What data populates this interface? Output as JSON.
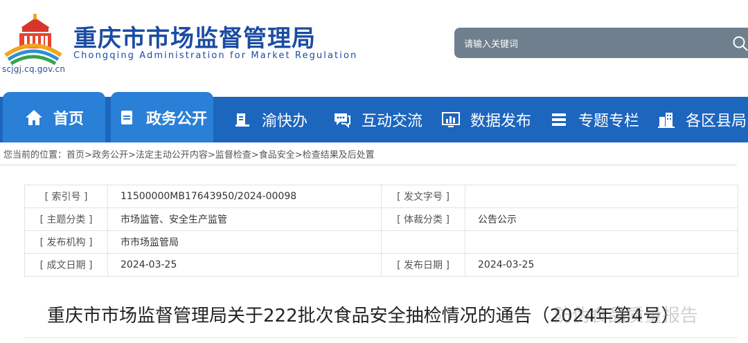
{
  "site": {
    "title": "重庆市市场监督管理局",
    "subtitle": "Chongqing  Administration for Market Regulation",
    "domain": "scjgj.cq.gov.cn",
    "logo_icon": "emblem-logo-icon"
  },
  "search": {
    "placeholder": "请输入关键词",
    "icon": "search-icon"
  },
  "nav": {
    "items": [
      {
        "label": "首页",
        "icon": "home-icon"
      },
      {
        "label": "政务公开",
        "icon": "document-icon"
      },
      {
        "label": "渝快办",
        "icon": "service-icon"
      },
      {
        "label": "互动交流",
        "icon": "chat-icon"
      },
      {
        "label": "数据发布",
        "icon": "chart-icon"
      },
      {
        "label": "专题专栏",
        "icon": "list-icon"
      },
      {
        "label": "各区县局",
        "icon": "building-icon"
      }
    ],
    "active": "政务公开"
  },
  "breadcrumb": {
    "prefix": "您当前的位置：",
    "items": [
      "首页",
      "政务公开",
      "法定主动公开内容",
      "监督检查",
      "食品安全",
      "检查结果及后处置"
    ],
    "separator": ">"
  },
  "info": {
    "index_label": "[ 索引号 ]",
    "index_value": "11500000MB17643950/2024-00098",
    "doc_no_label": "[ 发文字号 ]",
    "doc_no_value": "",
    "topic_label": "[ 主题分类 ]",
    "topic_value": "市场监管、安全生产监管",
    "genre_label": "[ 体裁分类 ]",
    "genre_value": "公告公示",
    "issuer_label": "[ 发布机构 ]",
    "issuer_value": "市市场监管局",
    "written_label": "[ 成文日期 ]",
    "written_value": "2024-03-25",
    "publish_label": "[ 发布日期 ]",
    "publish_value": "2024-03-25"
  },
  "document": {
    "title": "重庆市市场监督管理局关于222批次食品安全抽检情况的通告（2024年第4号）",
    "watermark": "防伪食品质量报告"
  },
  "colors": {
    "brand_blue": "#1c66be",
    "nav_active": "#2a7fd6",
    "title_blue": "#1b4ca3",
    "search_bg": "#6f7f8e"
  }
}
